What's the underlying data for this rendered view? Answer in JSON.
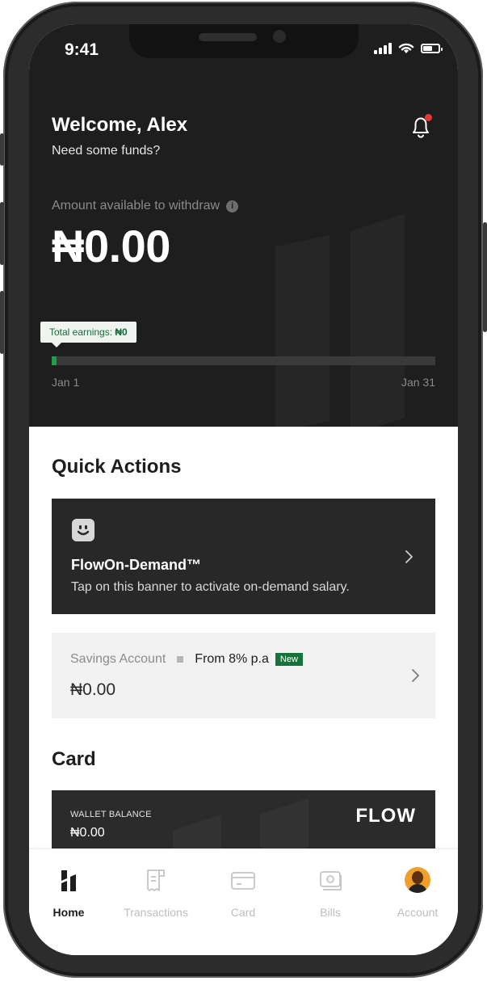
{
  "status_bar": {
    "time": "9:41"
  },
  "header": {
    "welcome": "Welcome, Alex",
    "subtitle": "Need some funds?",
    "has_notification": true
  },
  "withdraw": {
    "label": "Amount available to withdraw",
    "info_icon": "info-icon",
    "amount": "₦0.00"
  },
  "earnings": {
    "tooltip_prefix": "Total earnings: ",
    "tooltip_value": "₦0",
    "start_date": "Jan 1",
    "end_date": "Jan 31",
    "progress_fraction": 0.012,
    "progress_color": "#1ea04a"
  },
  "quick_actions": {
    "title": "Quick Actions",
    "flow_on_demand": {
      "title": "FlowOn-Demand™",
      "description": "Tap on this banner to activate on-demand salary.",
      "icon": "smiley-face-icon"
    },
    "savings": {
      "label": "Savings Account",
      "rate": "From 8% p.a",
      "badge": "New",
      "amount": "₦0.00"
    }
  },
  "card_section": {
    "title": "Card",
    "wallet_label": "WALLET BALANCE",
    "wallet_amount": "₦0.00",
    "brand": "FLOW"
  },
  "tab_bar": {
    "tabs": [
      {
        "label": "Home",
        "icon": "home-logo-icon",
        "active": true
      },
      {
        "label": "Transactions",
        "icon": "receipt-icon",
        "active": false
      },
      {
        "label": "Card",
        "icon": "card-icon",
        "active": false
      },
      {
        "label": "Bills",
        "icon": "bills-icon",
        "active": false
      },
      {
        "label": "Account",
        "icon": "avatar",
        "active": false
      }
    ]
  },
  "colors": {
    "dark_background": "#1e1e1e",
    "accent_green": "#17723c",
    "notification_dot": "#e53935"
  }
}
